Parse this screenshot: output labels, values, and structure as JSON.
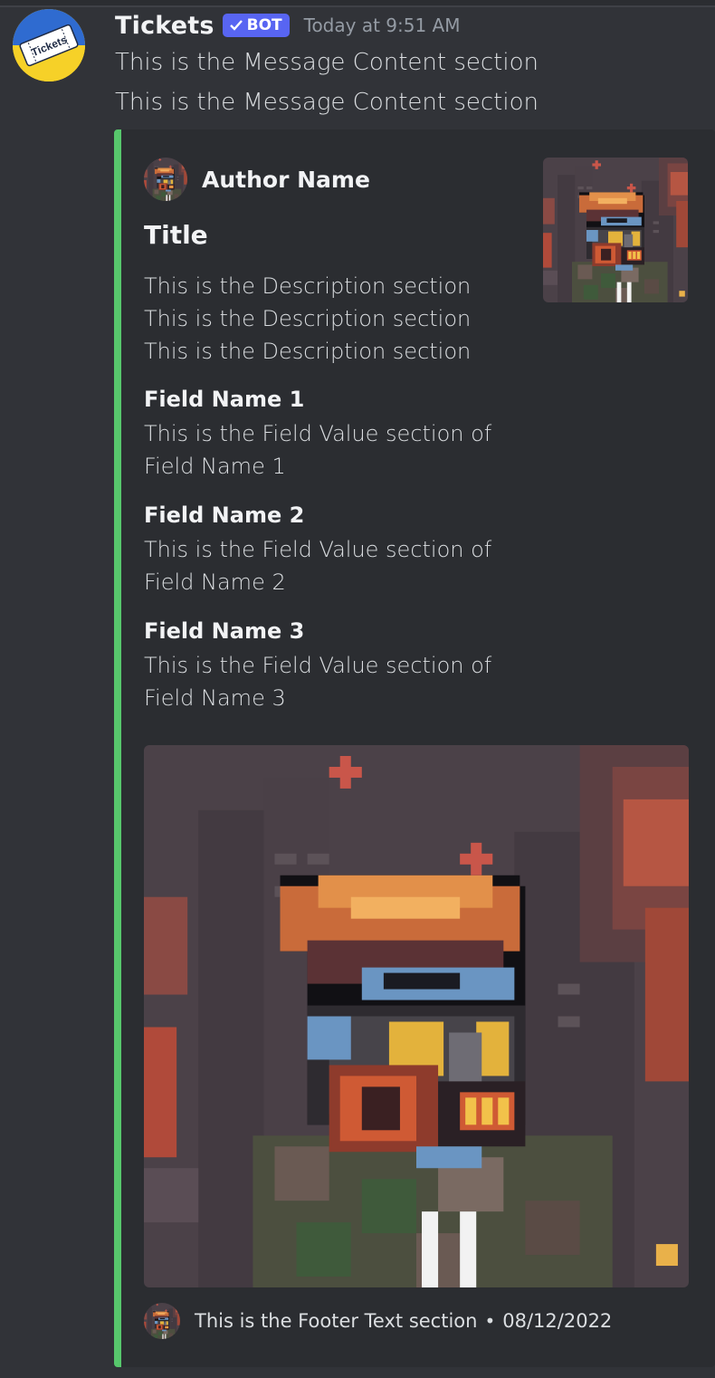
{
  "message": {
    "username": "Tickets",
    "badge": "BOT",
    "timestamp": "Today at 9:51 AM",
    "content": [
      "This is the Message Content section",
      "This is the Message Content section"
    ]
  },
  "embed": {
    "accent_color": "#57c76c",
    "author_name": "Author Name",
    "title": "Title",
    "description": [
      "This is the Description section",
      "This is the Description section",
      "This is the Description section"
    ],
    "fields": [
      {
        "name": "Field Name 1",
        "value_line1": "This is the Field Value section of",
        "value_line2": "Field Name 1"
      },
      {
        "name": "Field Name 2",
        "value_line1": "This is the Field Value section of",
        "value_line2": "Field Name 2"
      },
      {
        "name": "Field Name 3",
        "value_line1": "This is the Field Value section of",
        "value_line2": "Field Name 3"
      }
    ],
    "footer_text": "This is the Footer Text section",
    "footer_separator": "•",
    "footer_date": "08/12/2022"
  },
  "avatar_logo_text": "Tickets",
  "icons": {
    "avatar": "tickets-logo-icon",
    "verified": "checkmark-icon",
    "author": "gas-mask-character-icon",
    "thumbnail": "gas-mask-character-image",
    "image": "gas-mask-character-image",
    "footer": "gas-mask-character-icon"
  }
}
